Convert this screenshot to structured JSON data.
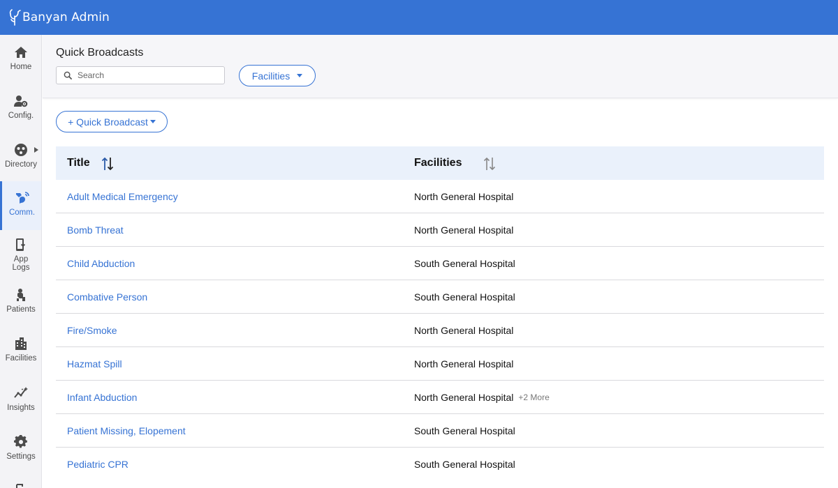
{
  "app": {
    "title": "Banyan Admin",
    "accent": "#3673d4"
  },
  "sidebar": {
    "items": [
      {
        "label": "Home",
        "icon": "home-icon"
      },
      {
        "label": "Config.",
        "icon": "user-gear-icon"
      },
      {
        "label": "Directory",
        "icon": "directory-icon"
      },
      {
        "label": "Comm.",
        "icon": "communication-icon",
        "active": true
      },
      {
        "label": "App Logs",
        "icon": "app-logs-icon"
      },
      {
        "label": "Patients",
        "icon": "patient-icon"
      },
      {
        "label": "Facilities",
        "icon": "building-icon"
      },
      {
        "label": "Insights",
        "icon": "insights-icon"
      },
      {
        "label": "Settings",
        "icon": "gear-icon"
      }
    ]
  },
  "header": {
    "page_title": "Quick Broadcasts",
    "search_placeholder": "Search",
    "facilities_filter_label": "Facilities"
  },
  "toolbar": {
    "add_label": "+ Quick Broadcast"
  },
  "table": {
    "columns": [
      "Title",
      "Facilities"
    ],
    "rows": [
      {
        "title": "Adult Medical Emergency",
        "facility": "North General Hospital",
        "more": ""
      },
      {
        "title": "Bomb Threat",
        "facility": "North General Hospital",
        "more": ""
      },
      {
        "title": "Child Abduction",
        "facility": "South General Hospital",
        "more": ""
      },
      {
        "title": "Combative Person",
        "facility": "South General Hospital",
        "more": ""
      },
      {
        "title": "Fire/Smoke",
        "facility": "North General Hospital",
        "more": ""
      },
      {
        "title": "Hazmat Spill",
        "facility": "North General Hospital",
        "more": ""
      },
      {
        "title": "Infant Abduction",
        "facility": "North General Hospital",
        "more": "+2 More"
      },
      {
        "title": "Patient Missing, Elopement",
        "facility": "South General Hospital",
        "more": ""
      },
      {
        "title": "Pediatric CPR",
        "facility": "South General Hospital",
        "more": ""
      }
    ]
  }
}
